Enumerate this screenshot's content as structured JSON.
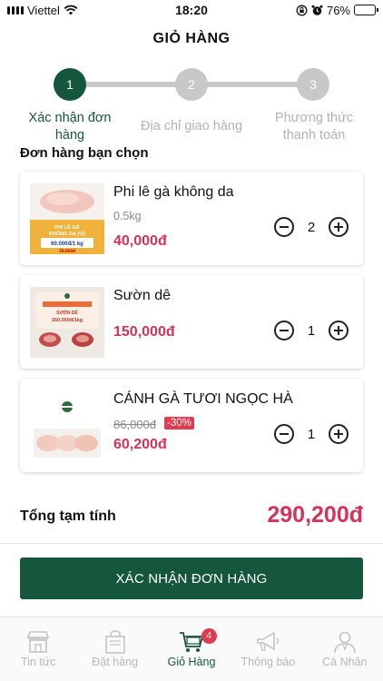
{
  "status_bar": {
    "carrier": "Viettel",
    "time": "18:20",
    "battery": "76%",
    "battery_level": 0.76
  },
  "header": {
    "title": "GIỎ HÀNG"
  },
  "stepper": {
    "steps": [
      {
        "number": "1",
        "label_line1": "Xác nhận đơn",
        "label_line2": "hàng",
        "active": true
      },
      {
        "number": "2",
        "label_line1": "Địa chỉ giao hàng",
        "label_line2": "",
        "active": false
      },
      {
        "number": "3",
        "label_line1": "Phương thức",
        "label_line2": "thanh toán",
        "active": false
      }
    ]
  },
  "order": {
    "section_title": "Đơn hàng bạn chọn",
    "items": [
      {
        "name": "Phi lê gà không da",
        "weight": "0.5kg",
        "price": "40,000đ",
        "quantity": "2",
        "thumb_text": {
          "line1": "PHI LÊ GÀ",
          "line2": "KHÔNG DA (VỈ)",
          "price": "60.000đ/1 kg",
          "old": "75.000đ"
        }
      },
      {
        "name": "Sườn dê",
        "price": "150,000đ",
        "quantity": "1",
        "thumb_text": {
          "line1": "SƯỜN DÊ",
          "price": "150.000đ/1kg"
        }
      },
      {
        "name": "CÁNH GÀ TƯƠI NGỌC HÀ",
        "old_price": "86,000đ",
        "discount": "-30%",
        "price": "60,200đ",
        "quantity": "1"
      }
    ]
  },
  "summary": {
    "label": "Tổng tạm tính",
    "value": "290,200đ"
  },
  "confirm_button": {
    "label": "XÁC NHẬN ĐƠN HÀNG"
  },
  "bottom_nav": {
    "items": [
      {
        "label": "Tin tức",
        "icon": "store-icon",
        "active": false
      },
      {
        "label": "Đặt hàng",
        "icon": "shopping-bag-icon",
        "active": false
      },
      {
        "label": "Giỏ Hàng",
        "icon": "cart-icon",
        "active": true,
        "badge": "4"
      },
      {
        "label": "Thông báo",
        "icon": "megaphone-icon",
        "active": false
      },
      {
        "label": "Cá Nhân",
        "icon": "user-icon",
        "active": false
      }
    ]
  },
  "colors": {
    "primary_green": "#15573c",
    "price_red": "#d6325a",
    "badge_red": "#e03b4f",
    "inactive_gray": "#c8c8c8"
  }
}
